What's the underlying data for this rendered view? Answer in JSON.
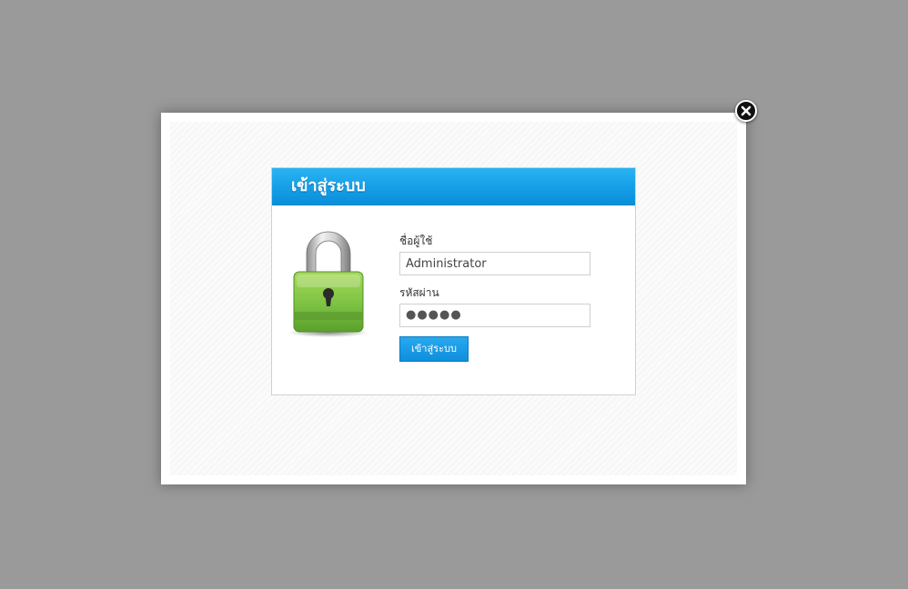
{
  "dialog": {
    "close_icon": "close-icon"
  },
  "login": {
    "title": "เข้าสู่ระบบ",
    "lock_icon": "padlock-icon",
    "username_label": "ชื่อผู้ใช้",
    "username_value": "Administrator",
    "password_label": "รหัสผ่าน",
    "password_value": "●●●●●",
    "submit_label": "เข้าสู่ระบบ"
  },
  "colors": {
    "header_blue": "#149ee6",
    "button_blue": "#0f8fdc",
    "lock_green": "#7cc242",
    "overlay_gray": "#9a9a9a"
  }
}
